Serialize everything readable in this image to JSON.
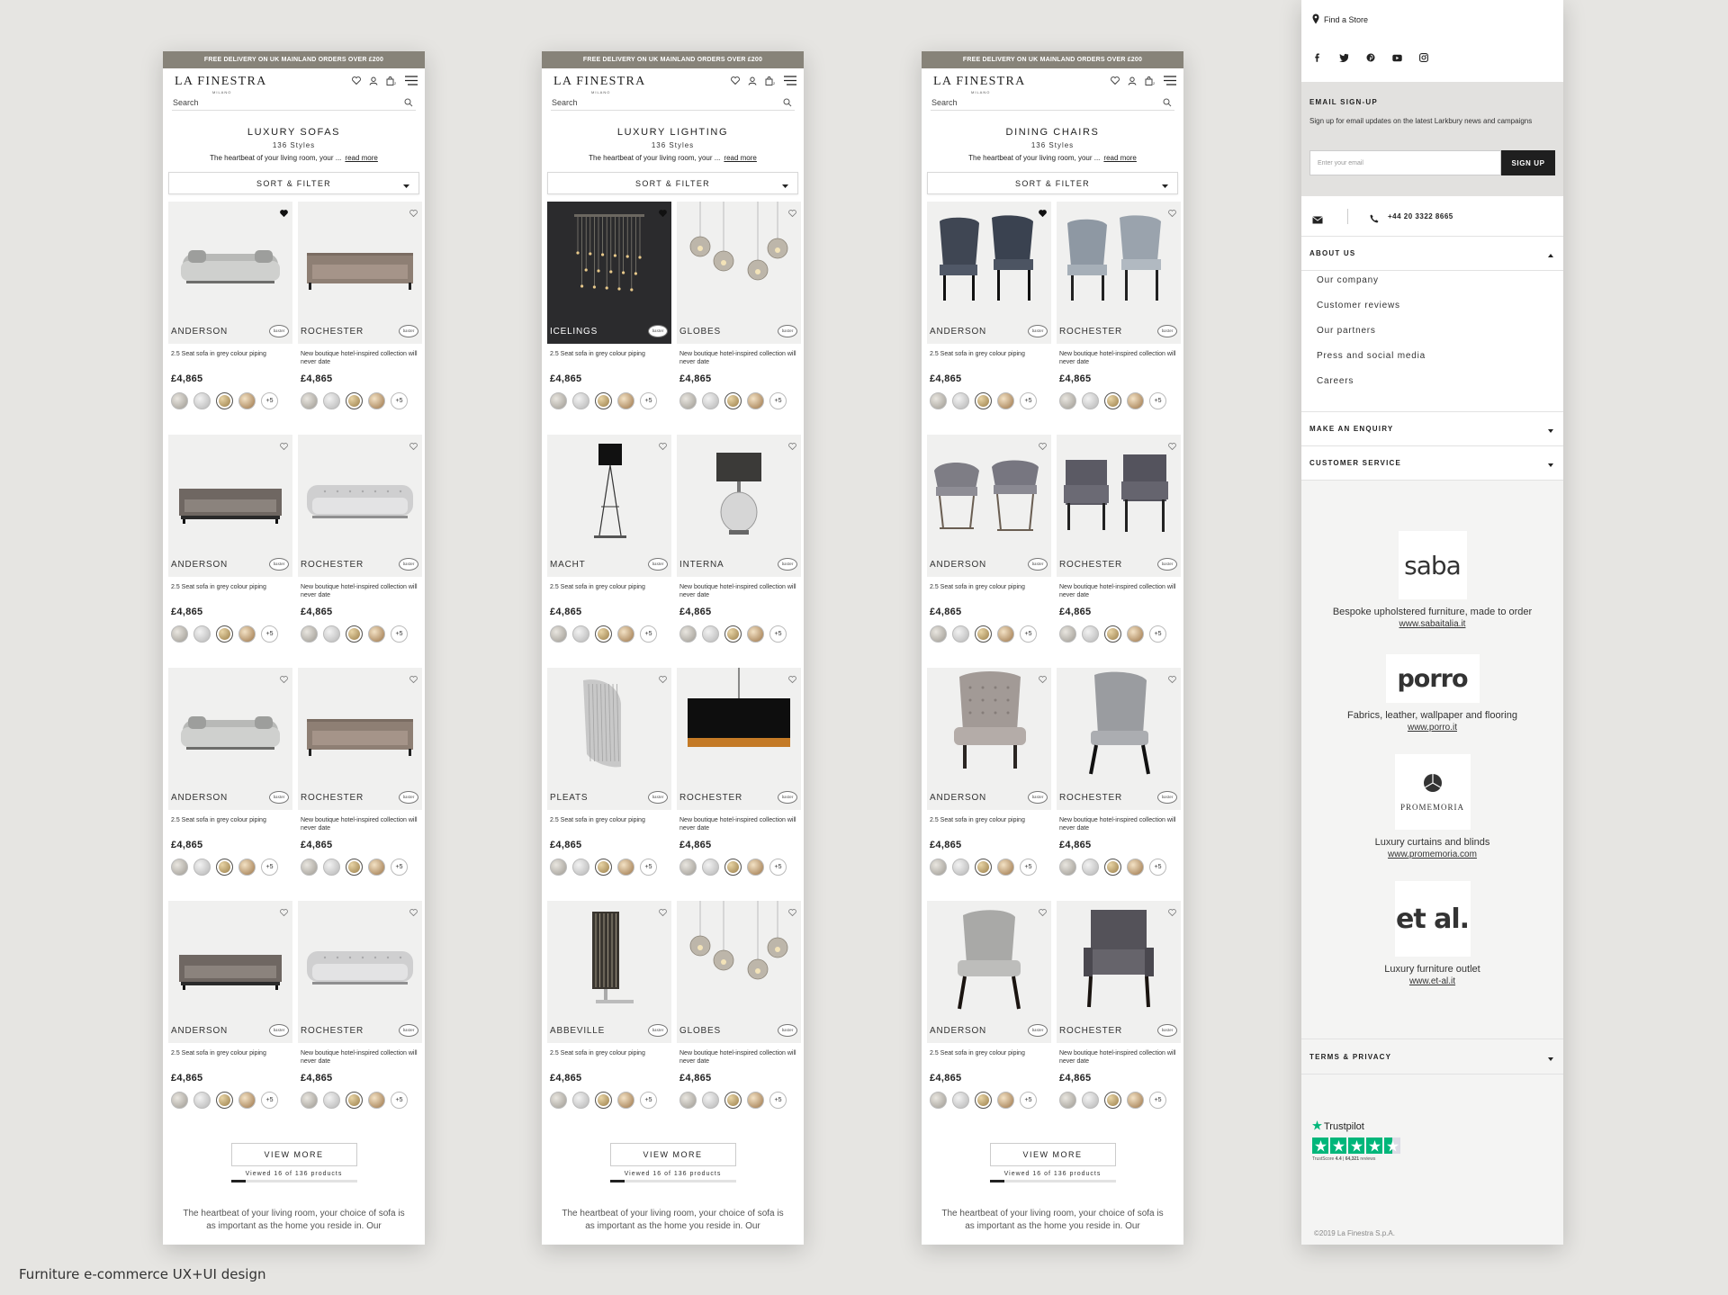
{
  "caption": "Furniture e-commerce UX+UI design",
  "common": {
    "banner": "FREE DELIVERY ON UK MAINLAND ORDERS OVER £200",
    "logo": "LA FINESTRA",
    "logo_sub": "MILANO",
    "search_placeholder": "Search",
    "cat_desc": "The heartbeat of your living room, your ...",
    "read_more": "read more",
    "sort_filter": "SORT & FILTER",
    "desc_a": "2.5 Seat sofa in grey colour piping",
    "desc_b": "New boutique hotel-inspired collection will never date",
    "price": "£4,865",
    "badge": "baxter",
    "more_swatches": "+5",
    "view_more": "VIEW MORE",
    "viewed": "Viewed 16 of 136 products",
    "viewed_fraction": 0.118,
    "bottom_text": "The heartbeat of your living room, your choice of sofa is as important as the home you reside in. Our"
  },
  "phones": [
    {
      "title": "LUXURY SOFAS",
      "count": "136 Styles",
      "products": [
        {
          "name": "ANDERSON",
          "desc": "2.5 Seat sofa in grey colour piping",
          "fav": true,
          "img": "sofa-velvet"
        },
        {
          "name": "ROCHESTER",
          "desc": "New boutique hotel-inspired collection will never date",
          "fav": false,
          "img": "sofa-taupe"
        },
        {
          "name": "ANDERSON",
          "desc": "2.5 Seat sofa in grey colour piping",
          "fav": false,
          "img": "sofa-dark"
        },
        {
          "name": "ROCHESTER",
          "desc": "New boutique hotel-inspired collection will never date",
          "fav": false,
          "img": "sofa-chesterfield"
        },
        {
          "name": "ANDERSON",
          "desc": "2.5 Seat sofa in grey colour piping",
          "fav": false,
          "img": "sofa-velvet"
        },
        {
          "name": "ROCHESTER",
          "desc": "New boutique hotel-inspired collection will never date",
          "fav": false,
          "img": "sofa-taupe"
        },
        {
          "name": "ANDERSON",
          "desc": "2.5 Seat sofa in grey colour piping",
          "fav": false,
          "img": "sofa-dark"
        },
        {
          "name": "ROCHESTER",
          "desc": "New boutique hotel-inspired collection will never date",
          "fav": false,
          "img": "sofa-chesterfield"
        }
      ]
    },
    {
      "title": "LUXURY LIGHTING",
      "count": "136 Styles",
      "products": [
        {
          "name": "ICELINGS",
          "desc": "2.5 Seat sofa in grey colour piping",
          "fav": true,
          "img": "chandelier"
        },
        {
          "name": "GLOBES",
          "desc": "New boutique hotel-inspired collection will never date",
          "fav": false,
          "img": "globes"
        },
        {
          "name": "MACHT",
          "desc": "2.5 Seat sofa in grey colour piping",
          "fav": false,
          "img": "floor-lamp"
        },
        {
          "name": "INTERNA",
          "desc": "New boutique hotel-inspired collection will never date",
          "fav": false,
          "img": "table-lamp"
        },
        {
          "name": "PLEATS",
          "desc": "2.5 Seat sofa in grey colour piping",
          "fav": false,
          "img": "wall-light"
        },
        {
          "name": "ROCHESTER",
          "desc": "New boutique hotel-inspired collection will never date",
          "fav": false,
          "img": "drum-pendant"
        },
        {
          "name": "ABBEVILLE",
          "desc": "2.5 Seat sofa in grey colour piping",
          "fav": false,
          "img": "crystal-lamp"
        },
        {
          "name": "GLOBES",
          "desc": "New boutique hotel-inspired collection will never date",
          "fav": false,
          "img": "globes"
        }
      ]
    },
    {
      "title": "DINING CHAIRS",
      "count": "136 Styles",
      "products": [
        {
          "name": "ANDERSON",
          "desc": "2.5 Seat sofa in grey colour piping",
          "fav": true,
          "img": "chair-blue-pair"
        },
        {
          "name": "ROCHESTER",
          "desc": "New boutique hotel-inspired collection will never date",
          "fav": false,
          "img": "chair-grey-pair"
        },
        {
          "name": "ANDERSON",
          "desc": "2.5 Seat sofa in grey colour piping",
          "fav": false,
          "img": "chair-metal-pair"
        },
        {
          "name": "ROCHESTER",
          "desc": "New boutique hotel-inspired collection will never date",
          "fav": false,
          "img": "chair-arm-pair"
        },
        {
          "name": "ANDERSON",
          "desc": "2.5 Seat sofa in grey colour piping",
          "fav": false,
          "img": "chair-tufted"
        },
        {
          "name": "ROCHESTER",
          "desc": "New boutique hotel-inspired collection will never date",
          "fav": false,
          "img": "chair-single-grey"
        },
        {
          "name": "ANDERSON",
          "desc": "2.5 Seat sofa in grey colour piping",
          "fav": false,
          "img": "chair-single-light"
        },
        {
          "name": "ROCHESTER",
          "desc": "New boutique hotel-inspired collection will never date",
          "fav": false,
          "img": "chair-arm-dark"
        }
      ]
    }
  ],
  "footer": {
    "find_store": "Find a Store",
    "social": [
      "facebook-icon",
      "twitter-icon",
      "pinterest-icon",
      "youtube-icon",
      "instagram-icon"
    ],
    "email_title": "EMAIL SIGN-UP",
    "email_text": "Sign up for email updates on the latest Larkbury news and campaigns",
    "email_placeholder": "Enter your email",
    "signup": "SIGN UP",
    "phone": "+44 20 3322 8665",
    "about_title": "ABOUT US",
    "about_items": [
      "Our company",
      "Customer reviews",
      "Our partners",
      "Press and social media",
      "Careers"
    ],
    "enquiry": "MAKE AN ENQUIRY",
    "service": "CUSTOMER SERVICE",
    "brands": [
      {
        "logo": "saba",
        "tag": "Bespoke upholstered furniture, made to order",
        "url": "www.sabaitalia.it"
      },
      {
        "logo": "porro",
        "tag": "Fabrics, leather, wallpaper and flooring",
        "url": "www.porro.it"
      },
      {
        "logo": "PROMEMORIA",
        "tag": "Luxury curtains and blinds",
        "url": "www.promemoria.com"
      },
      {
        "logo": "et al.",
        "tag": "Luxury furniture outlet",
        "url": "www.et-al.it"
      }
    ],
    "terms": "TERMS & PRIVACY",
    "trustpilot": "Trustpilot",
    "trust_score_label": "TrustScore",
    "trust_score": "4.4",
    "trust_reviews": "64,321",
    "trust_reviews_label": "reviews",
    "copyright": "©2019 La Finestra S.p.A."
  }
}
